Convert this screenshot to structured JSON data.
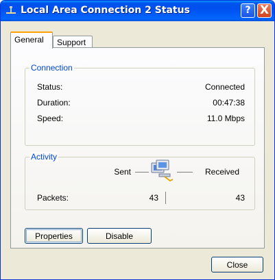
{
  "window": {
    "title": "Local Area Connection 2 Status",
    "help_symbol": "?",
    "close_symbol": "X",
    "icon": "network-connection-icon"
  },
  "tabs": [
    {
      "label": "General",
      "active": true
    },
    {
      "label": "Support",
      "active": false
    }
  ],
  "connection": {
    "group_label": "Connection",
    "rows": [
      {
        "label": "Status:",
        "value": "Connected"
      },
      {
        "label": "Duration:",
        "value": "00:47:38"
      },
      {
        "label": "Speed:",
        "value": "11.0 Mbps"
      }
    ]
  },
  "activity": {
    "group_label": "Activity",
    "sent_label": "Sent",
    "received_label": "Received",
    "packets_label": "Packets:",
    "packets_sent": "43",
    "packets_received": "43",
    "icon": "network-computers-icon"
  },
  "buttons": {
    "properties": "Properties",
    "disable": "Disable",
    "close": "Close"
  },
  "colors": {
    "titlebar": "#0054e3",
    "group_label": "#0046d5",
    "dialog_bg": "#ece9d8",
    "close_button": "#d2431d"
  }
}
